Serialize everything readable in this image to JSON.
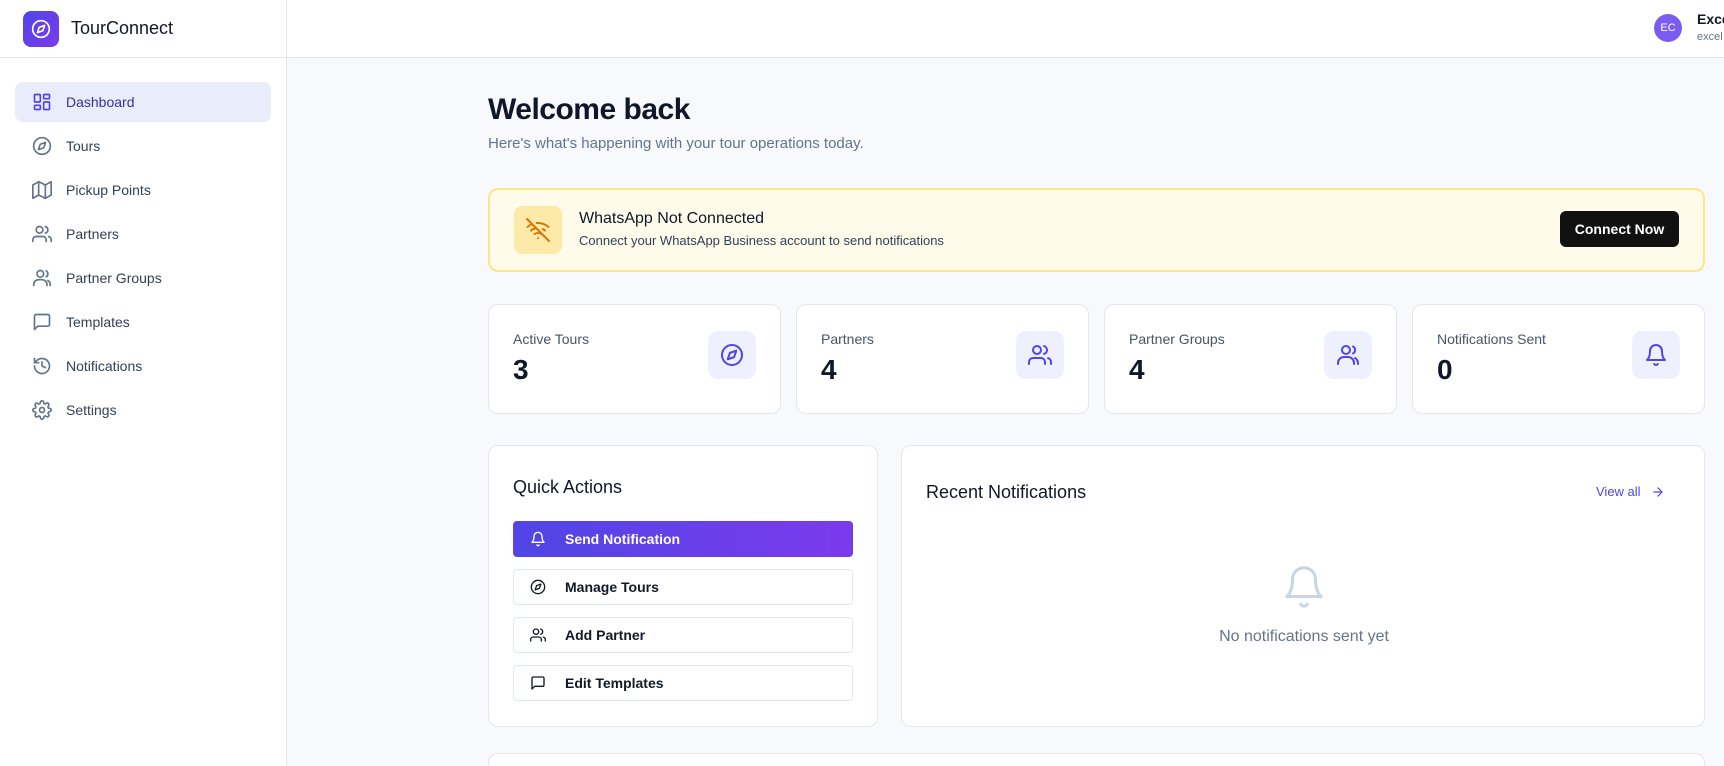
{
  "app": {
    "name": "TourConnect",
    "logo_icon": "compass-icon",
    "accent": "#4f46e5"
  },
  "sidebar": {
    "items": [
      {
        "label": "Dashboard",
        "icon": "dashboard-icon",
        "active": true
      },
      {
        "label": "Tours",
        "icon": "compass-icon"
      },
      {
        "label": "Pickup Points",
        "icon": "map-icon"
      },
      {
        "label": "Partners",
        "icon": "users-icon"
      },
      {
        "label": "Partner Groups",
        "icon": "user-group-icon"
      },
      {
        "label": "Templates",
        "icon": "message-square-icon"
      },
      {
        "label": "Notifications",
        "icon": "history-icon"
      },
      {
        "label": "Settings",
        "icon": "gear-icon"
      }
    ]
  },
  "topbar": {
    "avatar_initials": "EC",
    "user_name": "Exce",
    "user_email": "excel"
  },
  "header": {
    "title": "Welcome back",
    "subtitle": "Here's what's happening with your tour operations today."
  },
  "banner": {
    "icon": "wifi-off-icon",
    "title": "WhatsApp Not Connected",
    "text": "Connect your WhatsApp Business account to send notifications",
    "button_label": "Connect Now",
    "color": "#fde68a"
  },
  "stats": [
    {
      "label": "Active Tours",
      "value": "3",
      "icon": "compass-icon"
    },
    {
      "label": "Partners",
      "value": "4",
      "icon": "users-icon"
    },
    {
      "label": "Partner Groups",
      "value": "4",
      "icon": "user-group-icon"
    },
    {
      "label": "Notifications Sent",
      "value": "0",
      "icon": "bell-icon"
    }
  ],
  "quick_actions": {
    "title": "Quick Actions",
    "buttons": [
      {
        "label": "Send Notification",
        "icon": "bell-icon",
        "primary": true
      },
      {
        "label": "Manage Tours",
        "icon": "compass-icon"
      },
      {
        "label": "Add Partner",
        "icon": "users-icon"
      },
      {
        "label": "Edit Templates",
        "icon": "message-square-icon"
      }
    ]
  },
  "recent_notifications": {
    "title": "Recent Notifications",
    "view_all_label": "View all",
    "empty_icon": "bell-icon",
    "empty_text": "No notifications sent yet"
  }
}
